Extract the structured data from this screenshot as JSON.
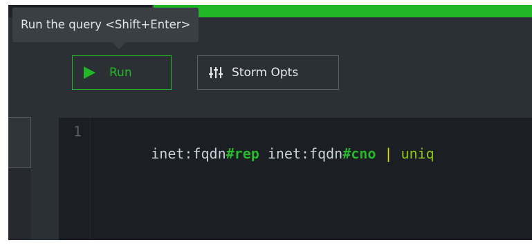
{
  "tooltip": {
    "text": "Run the query <Shift+Enter>"
  },
  "toolbar": {
    "run_label": "Run",
    "run_icon": "play-icon",
    "storm_opts_label": "Storm Opts",
    "storm_opts_icon": "sliders-icon"
  },
  "editor": {
    "line_numbers": [
      "1"
    ],
    "query_tokens": [
      {
        "text": "inet:fqdn",
        "kind": "plain"
      },
      {
        "text": "#rep",
        "kind": "tag"
      },
      {
        "text": " inet:fqdn",
        "kind": "plain"
      },
      {
        "text": "#cno",
        "kind": "tag"
      },
      {
        "text": " ",
        "kind": "plain"
      },
      {
        "text": "|",
        "kind": "pipe"
      },
      {
        "text": " ",
        "kind": "plain"
      },
      {
        "text": "uniq",
        "kind": "cmd"
      }
    ]
  },
  "colors": {
    "accent_green": "#21b726",
    "background": "#2b3035",
    "editor_background": "#1b1e22",
    "tag": "#28b62c",
    "pipe": "#d6d60a",
    "command": "#8fc60f"
  }
}
